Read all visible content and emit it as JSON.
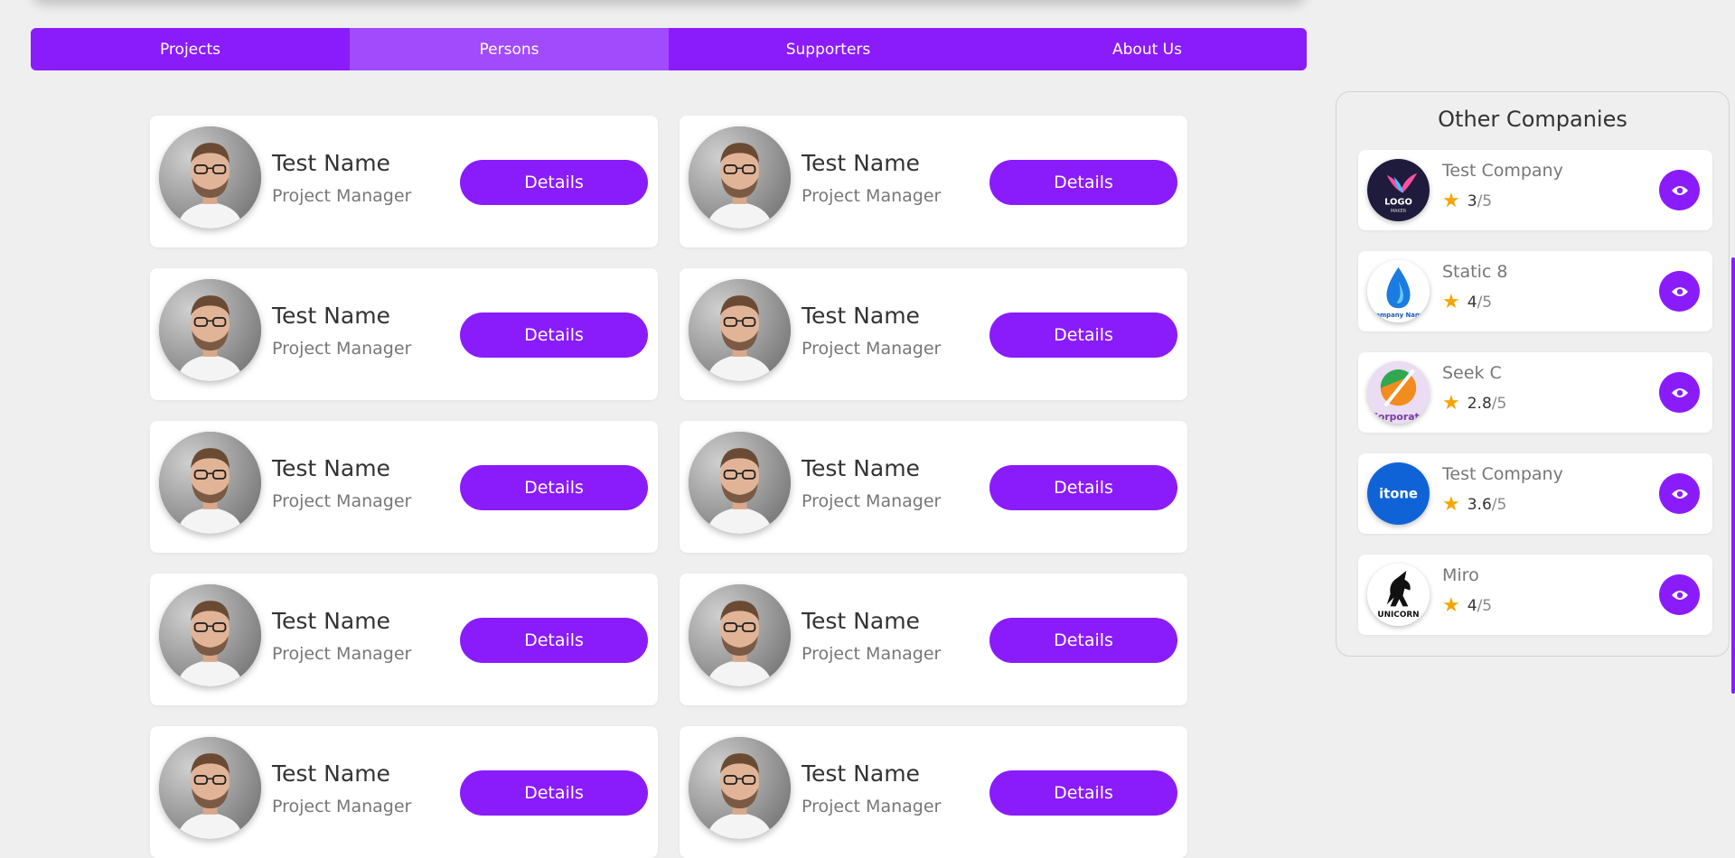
{
  "nav": {
    "tabs": [
      {
        "label": "Projects"
      },
      {
        "label": "Persons"
      },
      {
        "label": "Supporters"
      },
      {
        "label": "About Us"
      }
    ],
    "active_index": 1
  },
  "persons": [
    {
      "name": "Test Name",
      "role": "Project Manager",
      "button": "Details"
    },
    {
      "name": "Test Name",
      "role": "Project Manager",
      "button": "Details"
    },
    {
      "name": "Test Name",
      "role": "Project Manager",
      "button": "Details"
    },
    {
      "name": "Test Name",
      "role": "Project Manager",
      "button": "Details"
    },
    {
      "name": "Test Name",
      "role": "Project Manager",
      "button": "Details"
    },
    {
      "name": "Test Name",
      "role": "Project Manager",
      "button": "Details"
    },
    {
      "name": "Test Name",
      "role": "Project Manager",
      "button": "Details"
    },
    {
      "name": "Test Name",
      "role": "Project Manager",
      "button": "Details"
    },
    {
      "name": "Test Name",
      "role": "Project Manager",
      "button": "Details"
    },
    {
      "name": "Test Name",
      "role": "Project Manager",
      "button": "Details"
    }
  ],
  "sidebar": {
    "title": "Other Companies",
    "companies": [
      {
        "name": "Test Company",
        "rating": "3",
        "out_of": "/5",
        "logo": "logo-maker-bird-icon",
        "logo_text": "LOGO",
        "logo_subtext": "MAKER"
      },
      {
        "name": "Static 8",
        "rating": "4",
        "out_of": "/5",
        "logo": "water-drop-icon",
        "logo_text": "Company Name",
        "logo_subtext": ""
      },
      {
        "name": "Seek C",
        "rating": "2.8",
        "out_of": "/5",
        "logo": "leaf-icon",
        "logo_text": "Corporate",
        "logo_subtext": ""
      },
      {
        "name": "Test Company",
        "rating": "3.6",
        "out_of": "/5",
        "logo": "itone-icon",
        "logo_text": "itone",
        "logo_subtext": ""
      },
      {
        "name": "Miro",
        "rating": "4",
        "out_of": "/5",
        "logo": "unicorn-horse-icon",
        "logo_text": "UNICORN",
        "logo_subtext": ""
      }
    ]
  },
  "colors": {
    "accent": "#8a1cfb",
    "accent_active": "#a24bfd",
    "star": "#f6a500",
    "background": "#efefef"
  }
}
